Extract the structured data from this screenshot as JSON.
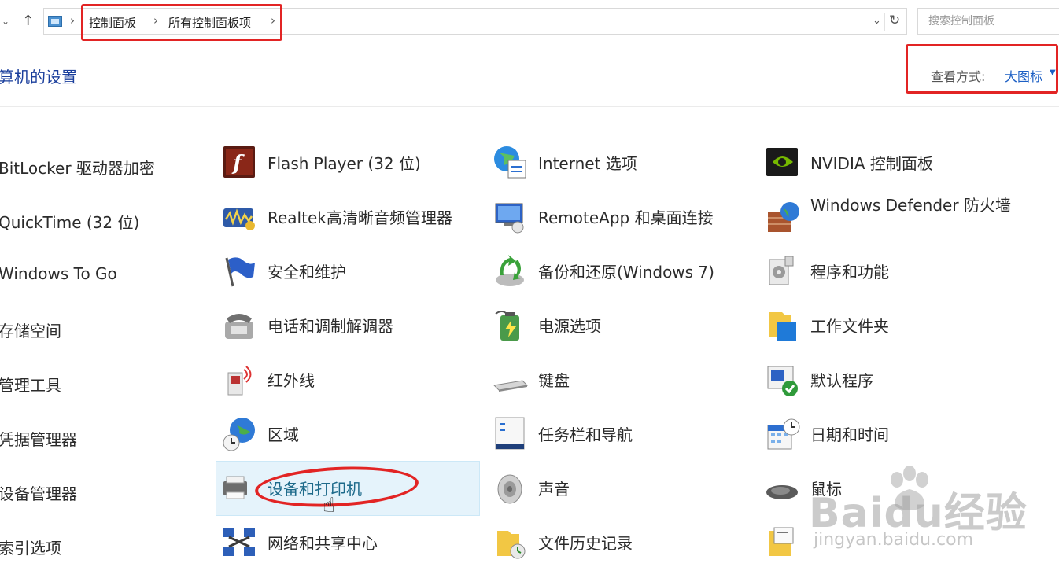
{
  "breadcrumb": [
    "控制面板",
    "所有控制面板项"
  ],
  "search": {
    "placeholder": "搜索控制面板"
  },
  "header": {
    "title": "算机的设置",
    "view_label": "查看方式:",
    "view_value": "大图标"
  },
  "items": [
    [
      "BitLocker 驱动器加密",
      "QuickTime (32 位)",
      "Windows To Go",
      "存储空间",
      "管理工具",
      "凭据管理器",
      "设备管理器",
      "索引选项"
    ],
    [
      "Flash Player (32 位)",
      "Realtek高清晰音频管理器",
      "安全和维护",
      "电话和调制解调器",
      "红外线",
      "区域",
      "设备和打印机",
      "网络和共享中心"
    ],
    [
      "Internet 选项",
      "RemoteApp 和桌面连接",
      "备份和还原(Windows 7)",
      "电源选项",
      "键盘",
      "任务栏和导航",
      "声音",
      "文件历史记录"
    ],
    [
      "NVIDIA 控制面板",
      "Windows Defender 防火墙",
      "程序和功能",
      "工作文件夹",
      "默认程序",
      "日期和时间",
      "鼠标",
      ""
    ]
  ],
  "watermark": {
    "logo": "Baidu经验",
    "url": "jingyan.baidu.com"
  },
  "colors": {
    "accent": "#1a3e9c",
    "highlight": "#e22424",
    "hover": "#e5f3fb"
  }
}
